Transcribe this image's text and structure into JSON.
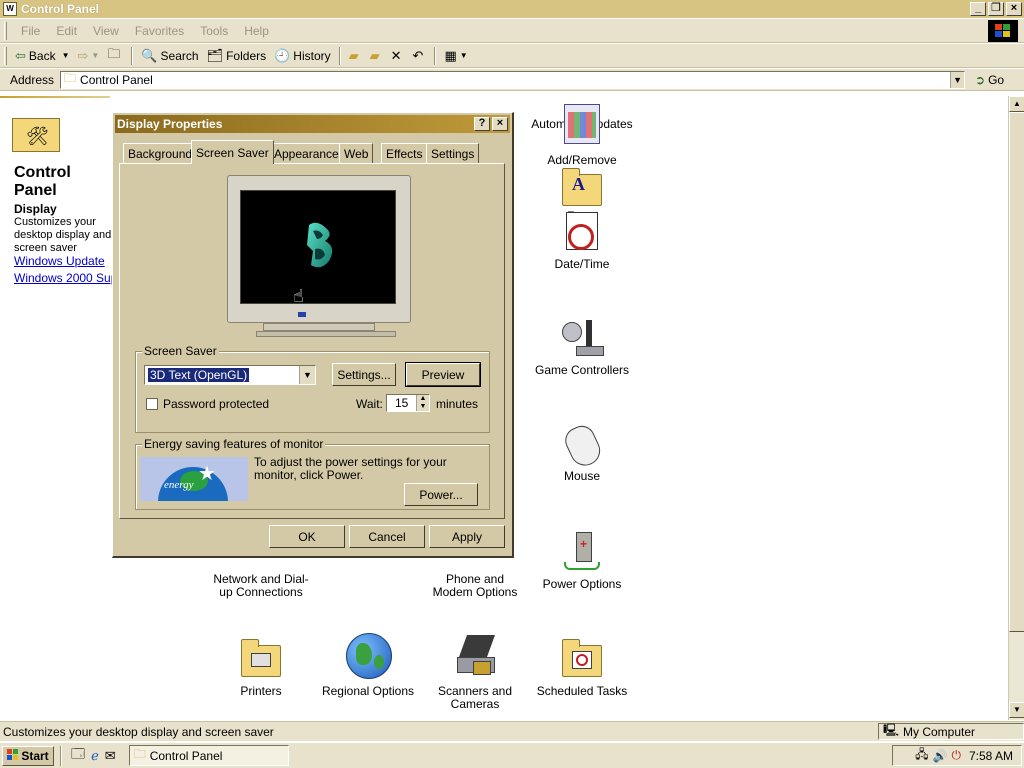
{
  "window": {
    "title": "Control Panel",
    "app_icon_text": "W"
  },
  "menu": [
    "File",
    "Edit",
    "View",
    "Favorites",
    "Tools",
    "Help"
  ],
  "toolbar": {
    "back": "Back",
    "search": "Search",
    "folders": "Folders",
    "history": "History"
  },
  "address": {
    "label": "Address",
    "value": "Control Panel",
    "go": "Go"
  },
  "left_panel": {
    "heading": "Control Panel",
    "desc_title": "Display",
    "desc_text": "Customizes your desktop display and screen saver",
    "links": [
      "Windows Update",
      "Windows 2000 Support"
    ]
  },
  "icons": {
    "auto_updates": "Automatic Updates",
    "add_remove": "Add/Remove",
    "fonts": "Fonts",
    "date_time": "Date/Time",
    "game_controllers": "Game Controllers",
    "mouse": "Mouse",
    "network": "Network and Dial-up Connections",
    "phone_modem": "Phone and Modem Options",
    "power_options": "Power Options",
    "printers": "Printers",
    "regional": "Regional Options",
    "scanners": "Scanners and Cameras",
    "scheduled": "Scheduled Tasks"
  },
  "dialog": {
    "title": "Display Properties",
    "help_btn": "?",
    "close_btn": "×",
    "tabs": [
      "Background",
      "Screen Saver",
      "Appearance",
      "Web",
      "Effects",
      "Settings"
    ],
    "active_tab": "Screen Saver",
    "screensaver": {
      "group_label": "Screen Saver",
      "selected": "3D Text (OpenGL)",
      "settings_btn": "Settings...",
      "preview_btn": "Preview",
      "password_label": "Password protected",
      "password_checked": false,
      "wait_label": "Wait:",
      "wait_value": "15",
      "wait_unit": "minutes"
    },
    "energy": {
      "group_label": "Energy saving features of monitor",
      "text": "To adjust the power settings for your monitor, click Power.",
      "power_btn": "Power..."
    },
    "buttons": {
      "ok": "OK",
      "cancel": "Cancel",
      "apply": "Apply"
    }
  },
  "status": {
    "message": "Customizes your desktop display and screen saver",
    "zone": "My Computer"
  },
  "taskbar": {
    "start": "Start",
    "task": "Control Panel",
    "clock": "7:58 AM"
  },
  "colors": {
    "title_bg": "#d7c382",
    "dialog_title": "#8a6a1e",
    "chrome": "#e8e2cc",
    "dialog_face": "#d4c9a6",
    "link": "#0000cc",
    "selection": "#1a2a7a"
  }
}
